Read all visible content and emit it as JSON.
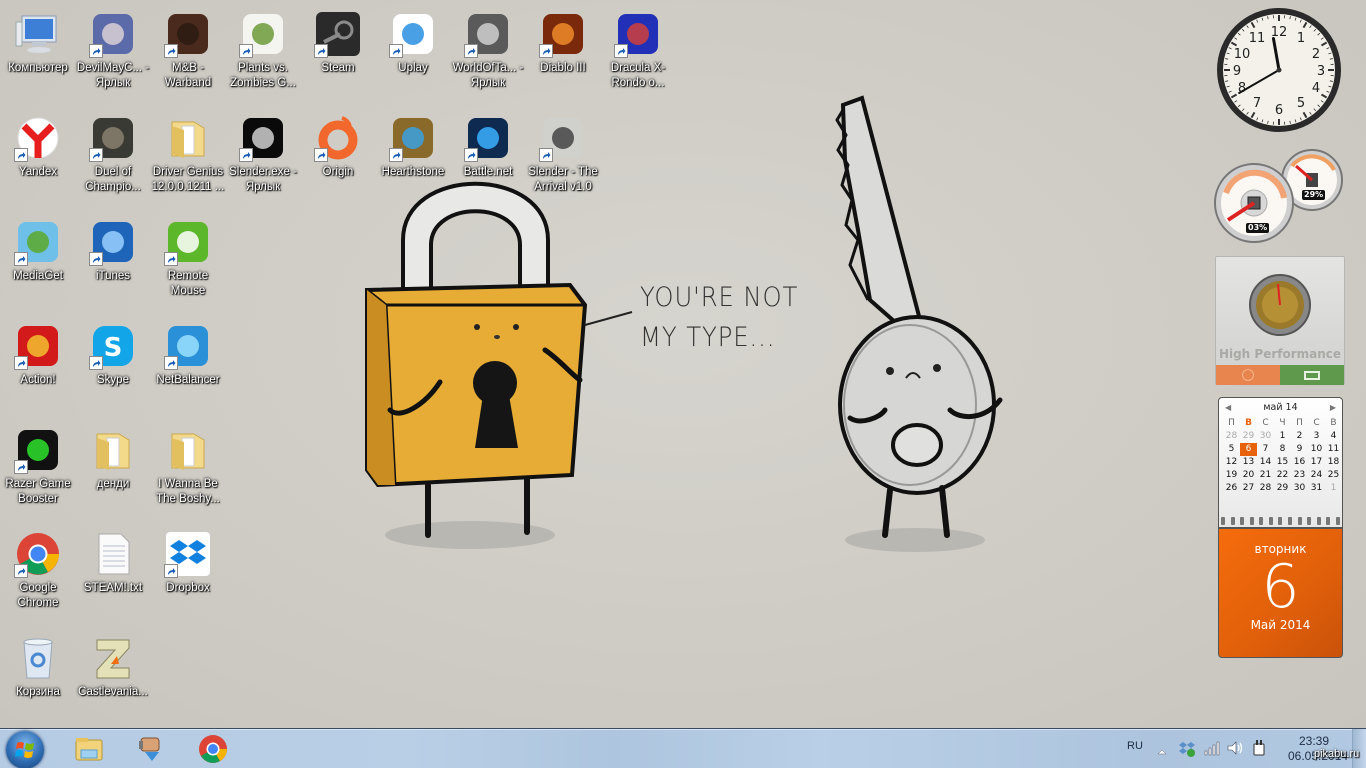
{
  "desktop": {
    "icons": [
      {
        "label": "Компьютер",
        "icon": "computer-icon",
        "shortcut": false
      },
      {
        "label": "DevilMayC... - Ярлык",
        "icon": "devil-may-cry-icon",
        "shortcut": true
      },
      {
        "label": "M&B - Warband",
        "icon": "mount-and-blade-icon",
        "shortcut": true
      },
      {
        "label": "Plants vs. Zombies G...",
        "icon": "plants-vs-zombies-icon",
        "shortcut": true
      },
      {
        "label": "Steam",
        "icon": "steam-icon",
        "shortcut": true
      },
      {
        "label": "Uplay",
        "icon": "uplay-icon",
        "shortcut": true
      },
      {
        "label": "WorldOfTa... - Ярлык",
        "icon": "world-of-tanks-icon",
        "shortcut": true
      },
      {
        "label": "Diablo III",
        "icon": "diablo-icon",
        "shortcut": true
      },
      {
        "label": "Dracula X- Rondo o...",
        "icon": "dracula-x-icon",
        "shortcut": true
      },
      {
        "label": "Yandex",
        "icon": "yandex-icon",
        "shortcut": true
      },
      {
        "label": "Duel of Champio...",
        "icon": "duel-of-champions-icon",
        "shortcut": true
      },
      {
        "label": "Driver Genius 12.0.0.1211 ...",
        "icon": "folder-icon",
        "shortcut": false
      },
      {
        "label": "Slender.exe - Ярлык",
        "icon": "slender-icon",
        "shortcut": true
      },
      {
        "label": "Origin",
        "icon": "origin-icon",
        "shortcut": true
      },
      {
        "label": "Hearthstone",
        "icon": "hearthstone-icon",
        "shortcut": true
      },
      {
        "label": "Battle.net",
        "icon": "battlenet-icon",
        "shortcut": true
      },
      {
        "label": "Slender - The Arrival v1.0",
        "icon": "slender-arrival-icon",
        "shortcut": true
      },
      {
        "label": "MediaGet",
        "icon": "mediaget-icon",
        "shortcut": true
      },
      {
        "label": "iTunes",
        "icon": "itunes-icon",
        "shortcut": true
      },
      {
        "label": "Remote Mouse",
        "icon": "remote-mouse-icon",
        "shortcut": true
      },
      {
        "label": "Action!",
        "icon": "action-icon",
        "shortcut": true
      },
      {
        "label": "Skype",
        "icon": "skype-icon",
        "shortcut": true
      },
      {
        "label": "NetBalancer",
        "icon": "netbalancer-icon",
        "shortcut": true
      },
      {
        "label": "Razer Game Booster",
        "icon": "razer-icon",
        "shortcut": true
      },
      {
        "label": "денди",
        "icon": "folder-icon",
        "shortcut": false
      },
      {
        "label": "I Wanna Be The Boshy...",
        "icon": "folder-icon",
        "shortcut": false
      },
      {
        "label": "Google Chrome",
        "icon": "chrome-icon",
        "shortcut": true
      },
      {
        "label": "STEAM!.txt",
        "icon": "text-file-icon",
        "shortcut": false
      },
      {
        "label": "Dropbox",
        "icon": "dropbox-icon",
        "shortcut": true
      },
      {
        "label": "Корзина",
        "icon": "recycle-bin-icon",
        "shortcut": false
      },
      {
        "label": "Castlevania...",
        "icon": "castlevania-icon",
        "shortcut": false
      }
    ]
  },
  "wallpaper": {
    "speech_line1": "YOU'RE NOT",
    "speech_line2": "MY TYPE..."
  },
  "gadgets": {
    "clock": {
      "hour": 11,
      "minute": 40
    },
    "cpu_meter": {
      "cpu_percent": 3,
      "cpu_label": "03%",
      "memory_percent": 29,
      "memory_label": "29%"
    },
    "power": {
      "label": "High Performance"
    },
    "calendar": {
      "month_label": "май 14",
      "weekdays": [
        "П",
        "В",
        "С",
        "Ч",
        "П",
        "С",
        "В"
      ],
      "today_weekday_index": 1,
      "weeks": [
        [
          "28",
          "29",
          "30",
          "1",
          "2",
          "3",
          "4"
        ],
        [
          "5",
          "6",
          "7",
          "8",
          "9",
          "10",
          "11"
        ],
        [
          "12",
          "13",
          "14",
          "15",
          "16",
          "17",
          "18"
        ],
        [
          "19",
          "20",
          "21",
          "22",
          "23",
          "24",
          "25"
        ],
        [
          "26",
          "27",
          "28",
          "29",
          "30",
          "31",
          "1"
        ]
      ],
      "today": "6",
      "day_name": "вторник",
      "day_number": "6",
      "month_year": "Май 2014",
      "accent": "#e8620c"
    }
  },
  "taskbar": {
    "pinned": [
      {
        "name": "windows-explorer",
        "icon": "explorer-icon"
      },
      {
        "name": "download-manager",
        "icon": "download-hand-icon"
      },
      {
        "name": "google-chrome",
        "icon": "chrome-icon"
      }
    ],
    "tray": {
      "language": "RU",
      "time": "23:39",
      "date": "06.05.2014"
    }
  },
  "watermark": "pikabu.ru"
}
